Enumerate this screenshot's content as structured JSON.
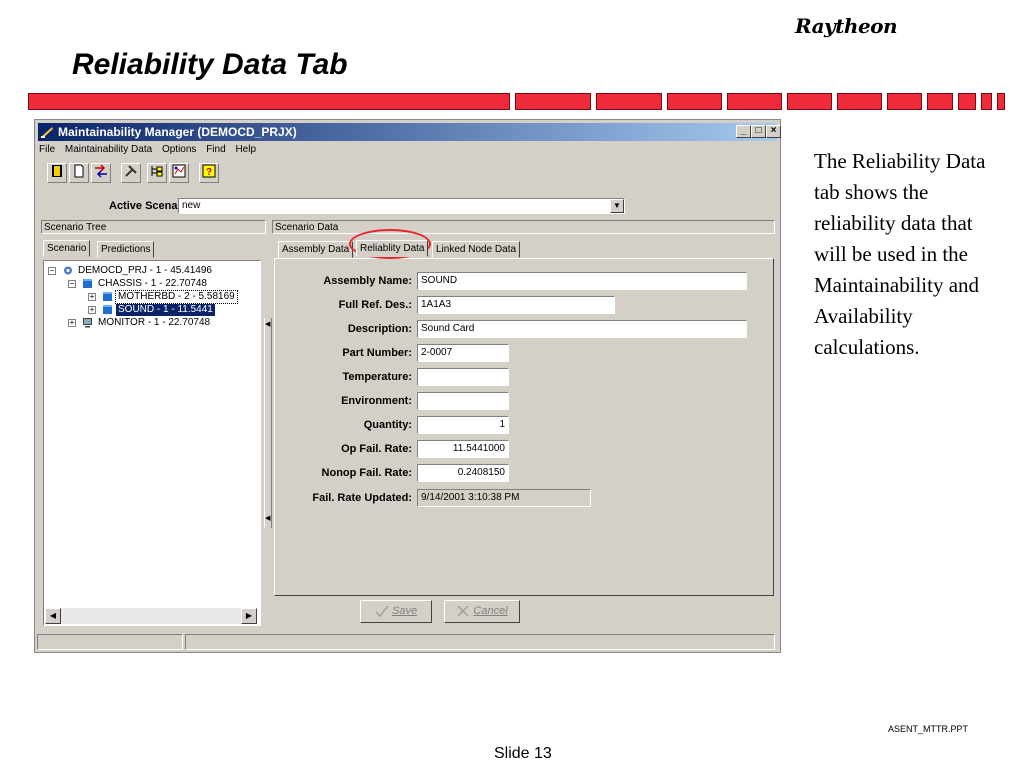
{
  "slide": {
    "title": "Reliability Data Tab",
    "brand": "Raytheon",
    "description": "The Reliability Data tab shows the reliability data that will be used in the Maintainability and Availability calculations.",
    "footer_file": "ASENT_MTTR.PPT",
    "footer_slide": "Slide 13",
    "accent_color": "#ee2a3b"
  },
  "window": {
    "title": "Maintainability Manager (DEMOCD_PRJX)",
    "min_label": "_",
    "max_label": "□",
    "close_label": "×",
    "menu": [
      "File",
      "Maintainability Data",
      "Options",
      "Find",
      "Help"
    ],
    "toolbar_icons": [
      "exit-icon",
      "new-icon",
      "move-icon",
      "tools-icon",
      "tree-icon",
      "chart-icon",
      "help-icon"
    ],
    "active_scenario_label": "Active Scenario:",
    "active_scenario_value": "new",
    "left_header": "Scenario Tree",
    "right_header": "Scenario Data",
    "left_tabs": [
      "Scenario",
      "Predictions"
    ],
    "right_tabs": [
      "Assembly Data",
      "Reliablity Data",
      "Linked Node Data"
    ],
    "tree": [
      {
        "label": "DEMOCD_PRJ  -  1  -  45.41496",
        "expander": "−"
      },
      {
        "label": "CHASSIS  -  1  -  22.70748",
        "expander": "−"
      },
      {
        "label": "MOTHERBD  -  2  -  5.58169",
        "expander": "+"
      },
      {
        "label": "SOUND  -  1  -  11.5441",
        "expander": "+"
      },
      {
        "label": "MONITOR  -  1  -  22.70748",
        "expander": "+"
      }
    ],
    "fields": {
      "assembly_name": {
        "label": "Assembly Name:",
        "value": "SOUND"
      },
      "full_ref_des": {
        "label": "Full Ref. Des.:",
        "value": "1A1A3"
      },
      "description": {
        "label": "Description:",
        "value": "Sound Card"
      },
      "part_number": {
        "label": "Part Number:",
        "value": "2-0007"
      },
      "temperature": {
        "label": "Temperature:",
        "value": ""
      },
      "environment": {
        "label": "Environment:",
        "value": ""
      },
      "quantity": {
        "label": "Quantity:",
        "value": "1"
      },
      "op_fail_rate": {
        "label": "Op Fail. Rate:",
        "value": "11.5441000"
      },
      "nonop_fail_rate": {
        "label": "Nonop Fail. Rate:",
        "value": "0.2408150"
      },
      "fail_rate_updated": {
        "label": "Fail. Rate Updated:",
        "value": "9/14/2001 3:10:38 PM"
      }
    },
    "save_label": "Save",
    "cancel_label": "Cancel"
  }
}
